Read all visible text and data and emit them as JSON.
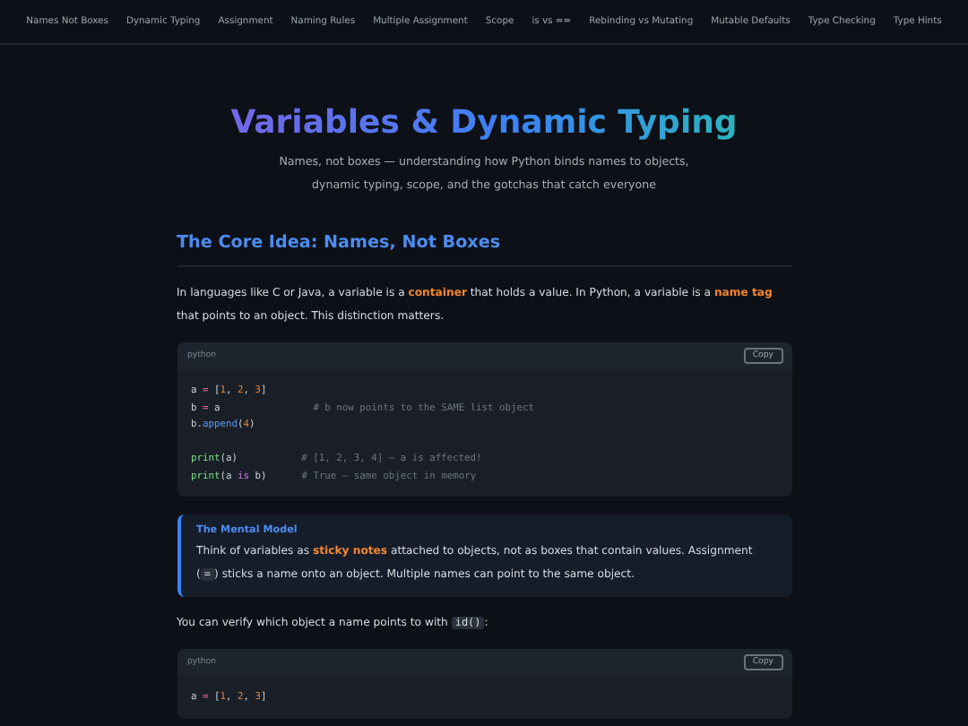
{
  "nav": [
    "Names Not Boxes",
    "Dynamic Typing",
    "Assignment",
    "Naming Rules",
    "Multiple Assignment",
    "Scope",
    "is vs ==",
    "Rebinding vs Mutating",
    "Mutable Defaults",
    "Type Checking",
    "Type Hints"
  ],
  "hero": {
    "title": "Variables & Dynamic Typing",
    "subtitle": "Names, not boxes — understanding how Python binds names to objects, dynamic typing, scope, and the gotchas that catch everyone"
  },
  "sections": [
    {
      "kind": "heading",
      "text": "The Core Idea: Names, Not Boxes"
    },
    {
      "kind": "paragraph",
      "segments": [
        {
          "kind": "text",
          "text": "In languages like C or Java, a variable is a "
        },
        {
          "kind": "em",
          "text": "container"
        },
        {
          "kind": "text",
          "text": " that holds a value. In Python, a variable is a "
        },
        {
          "kind": "em",
          "text": "name tag"
        },
        {
          "kind": "text",
          "text": " that points to an object. This distinction matters."
        }
      ]
    },
    {
      "kind": "code",
      "language": "python",
      "button": "Copy",
      "lines": [
        {
          "gap_before": false,
          "tokens": [
            {
              "kind": "name",
              "text": "a"
            },
            {
              "kind": "op",
              "text": " = "
            },
            {
              "kind": "plain",
              "text": "["
            },
            {
              "kind": "num",
              "text": "1"
            },
            {
              "kind": "plain",
              "text": ", "
            },
            {
              "kind": "num",
              "text": "2"
            },
            {
              "kind": "plain",
              "text": ", "
            },
            {
              "kind": "num",
              "text": "3"
            },
            {
              "kind": "plain",
              "text": "]"
            }
          ]
        },
        {
          "gap_before": false,
          "tokens": [
            {
              "kind": "name",
              "text": "b"
            },
            {
              "kind": "op",
              "text": " = "
            },
            {
              "kind": "name",
              "text": "a                "
            },
            {
              "kind": "comment",
              "text": "# b now points to the SAME list object"
            }
          ]
        },
        {
          "gap_before": false,
          "tokens": [
            {
              "kind": "name",
              "text": "b."
            },
            {
              "kind": "func",
              "text": "append"
            },
            {
              "kind": "plain",
              "text": "("
            },
            {
              "kind": "num",
              "text": "4"
            },
            {
              "kind": "plain",
              "text": ")"
            }
          ]
        },
        {
          "gap_before": true,
          "tokens": [
            {
              "kind": "builtin",
              "text": "print"
            },
            {
              "kind": "plain",
              "text": "(a)           "
            },
            {
              "kind": "comment",
              "text": "# [1, 2, 3, 4] — a is affected!"
            }
          ]
        },
        {
          "gap_before": false,
          "tokens": [
            {
              "kind": "builtin",
              "text": "print"
            },
            {
              "kind": "plain",
              "text": "(a "
            },
            {
              "kind": "keyword",
              "text": "is"
            },
            {
              "kind": "plain",
              "text": " b)      "
            },
            {
              "kind": "comment",
              "text": "# True — same object in memory"
            }
          ]
        }
      ]
    },
    {
      "kind": "callout",
      "title": "The Mental Model",
      "segments": [
        {
          "kind": "text",
          "text": "Think of variables as "
        },
        {
          "kind": "em",
          "text": "sticky notes"
        },
        {
          "kind": "text",
          "text": " attached to objects, not as boxes that contain values. Assignment ("
        },
        {
          "kind": "code",
          "text": "="
        },
        {
          "kind": "text",
          "text": ") sticks a name onto an object. Multiple names can point to the same object."
        }
      ]
    },
    {
      "kind": "paragraph",
      "segments": [
        {
          "kind": "text",
          "text": "You can verify which object a name points to with "
        },
        {
          "kind": "code",
          "text": "id()"
        },
        {
          "kind": "text",
          "text": ":"
        }
      ]
    },
    {
      "kind": "code",
      "language": "python",
      "button": "Copy",
      "lines": [
        {
          "gap_before": false,
          "tokens": [
            {
              "kind": "name",
              "text": "a"
            },
            {
              "kind": "op",
              "text": " = "
            },
            {
              "kind": "plain",
              "text": "["
            },
            {
              "kind": "num",
              "text": "1"
            },
            {
              "kind": "plain",
              "text": ", "
            },
            {
              "kind": "num",
              "text": "2"
            },
            {
              "kind": "plain",
              "text": ", "
            },
            {
              "kind": "num",
              "text": "3"
            },
            {
              "kind": "plain",
              "text": "]"
            }
          ]
        }
      ]
    }
  ]
}
